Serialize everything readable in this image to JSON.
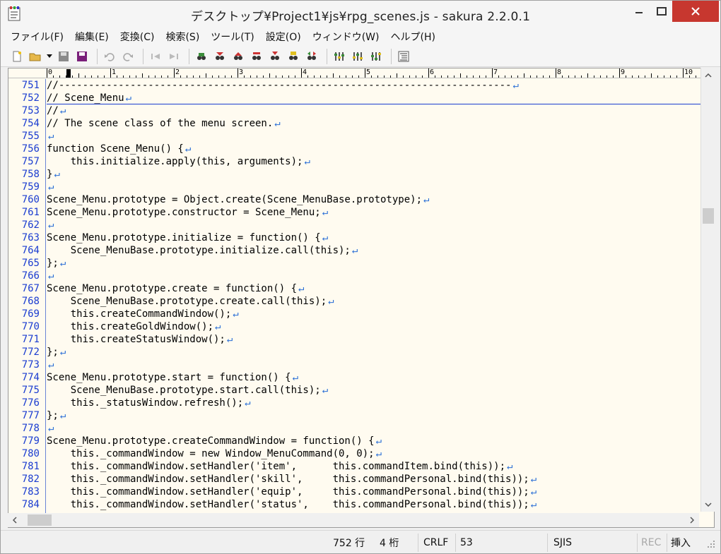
{
  "window": {
    "title": "デスクトップ¥Project1¥js¥rpg_scenes.js - sakura 2.2.0.1"
  },
  "menu": [
    "ファイル(F)",
    "編集(E)",
    "変換(C)",
    "検索(S)",
    "ツール(T)",
    "設定(O)",
    "ウィンドウ(W)",
    "ヘルプ(H)"
  ],
  "toolbar_icons": [
    "new-file-icon",
    "open-file-icon",
    "save-icon",
    "save-all-icon",
    "undo-icon",
    "redo-icon",
    "jump-back-icon",
    "jump-forward-icon",
    "search-icon",
    "search-next-icon",
    "search-prev-icon",
    "replace-icon",
    "bookmark-icon",
    "mark-icon",
    "tag-jump-icon",
    "settings-icon",
    "type-settings-icon",
    "common-settings-icon",
    "outline-icon"
  ],
  "ruler": {
    "marks": [
      "0",
      "1",
      "2",
      "3",
      "4",
      "5",
      "6",
      "7",
      "8",
      "9",
      "10"
    ]
  },
  "editor": {
    "background": "#fffbf0",
    "line_number_color": "#1a3cd0",
    "eol_marker": "↵",
    "lines": [
      {
        "num": "751",
        "text": "//----------------------------------------------------------------------------"
      },
      {
        "num": "752",
        "text": "// Scene_Menu"
      },
      {
        "num": "753",
        "text": "//"
      },
      {
        "num": "754",
        "text": "// The scene class of the menu screen."
      },
      {
        "num": "755",
        "text": ""
      },
      {
        "num": "756",
        "text": "function Scene_Menu() {"
      },
      {
        "num": "757",
        "text": "    this.initialize.apply(this, arguments);"
      },
      {
        "num": "758",
        "text": "}"
      },
      {
        "num": "759",
        "text": ""
      },
      {
        "num": "760",
        "text": "Scene_Menu.prototype = Object.create(Scene_MenuBase.prototype);"
      },
      {
        "num": "761",
        "text": "Scene_Menu.prototype.constructor = Scene_Menu;"
      },
      {
        "num": "762",
        "text": ""
      },
      {
        "num": "763",
        "text": "Scene_Menu.prototype.initialize = function() {"
      },
      {
        "num": "764",
        "text": "    Scene_MenuBase.prototype.initialize.call(this);"
      },
      {
        "num": "765",
        "text": "};"
      },
      {
        "num": "766",
        "text": ""
      },
      {
        "num": "767",
        "text": "Scene_Menu.prototype.create = function() {"
      },
      {
        "num": "768",
        "text": "    Scene_MenuBase.prototype.create.call(this);"
      },
      {
        "num": "769",
        "text": "    this.createCommandWindow();"
      },
      {
        "num": "770",
        "text": "    this.createGoldWindow();"
      },
      {
        "num": "771",
        "text": "    this.createStatusWindow();"
      },
      {
        "num": "772",
        "text": "};"
      },
      {
        "num": "773",
        "text": ""
      },
      {
        "num": "774",
        "text": "Scene_Menu.prototype.start = function() {"
      },
      {
        "num": "775",
        "text": "    Scene_MenuBase.prototype.start.call(this);"
      },
      {
        "num": "776",
        "text": "    this._statusWindow.refresh();"
      },
      {
        "num": "777",
        "text": "};"
      },
      {
        "num": "778",
        "text": ""
      },
      {
        "num": "779",
        "text": "Scene_Menu.prototype.createCommandWindow = function() {"
      },
      {
        "num": "780",
        "text": "    this._commandWindow = new Window_MenuCommand(0, 0);"
      },
      {
        "num": "781",
        "text": "    this._commandWindow.setHandler('item',      this.commandItem.bind(this));"
      },
      {
        "num": "782",
        "text": "    this._commandWindow.setHandler('skill',     this.commandPersonal.bind(this));"
      },
      {
        "num": "783",
        "text": "    this._commandWindow.setHandler('equip',     this.commandPersonal.bind(this));"
      },
      {
        "num": "784",
        "text": "    this._commandWindow.setHandler('status',    this.commandPersonal.bind(this));"
      }
    ]
  },
  "statusbar": {
    "line": "752 行",
    "column": "4 桁",
    "newline": "CRLF",
    "char_code": "53",
    "encoding": "SJIS",
    "rec": "REC",
    "mode": "挿入"
  }
}
